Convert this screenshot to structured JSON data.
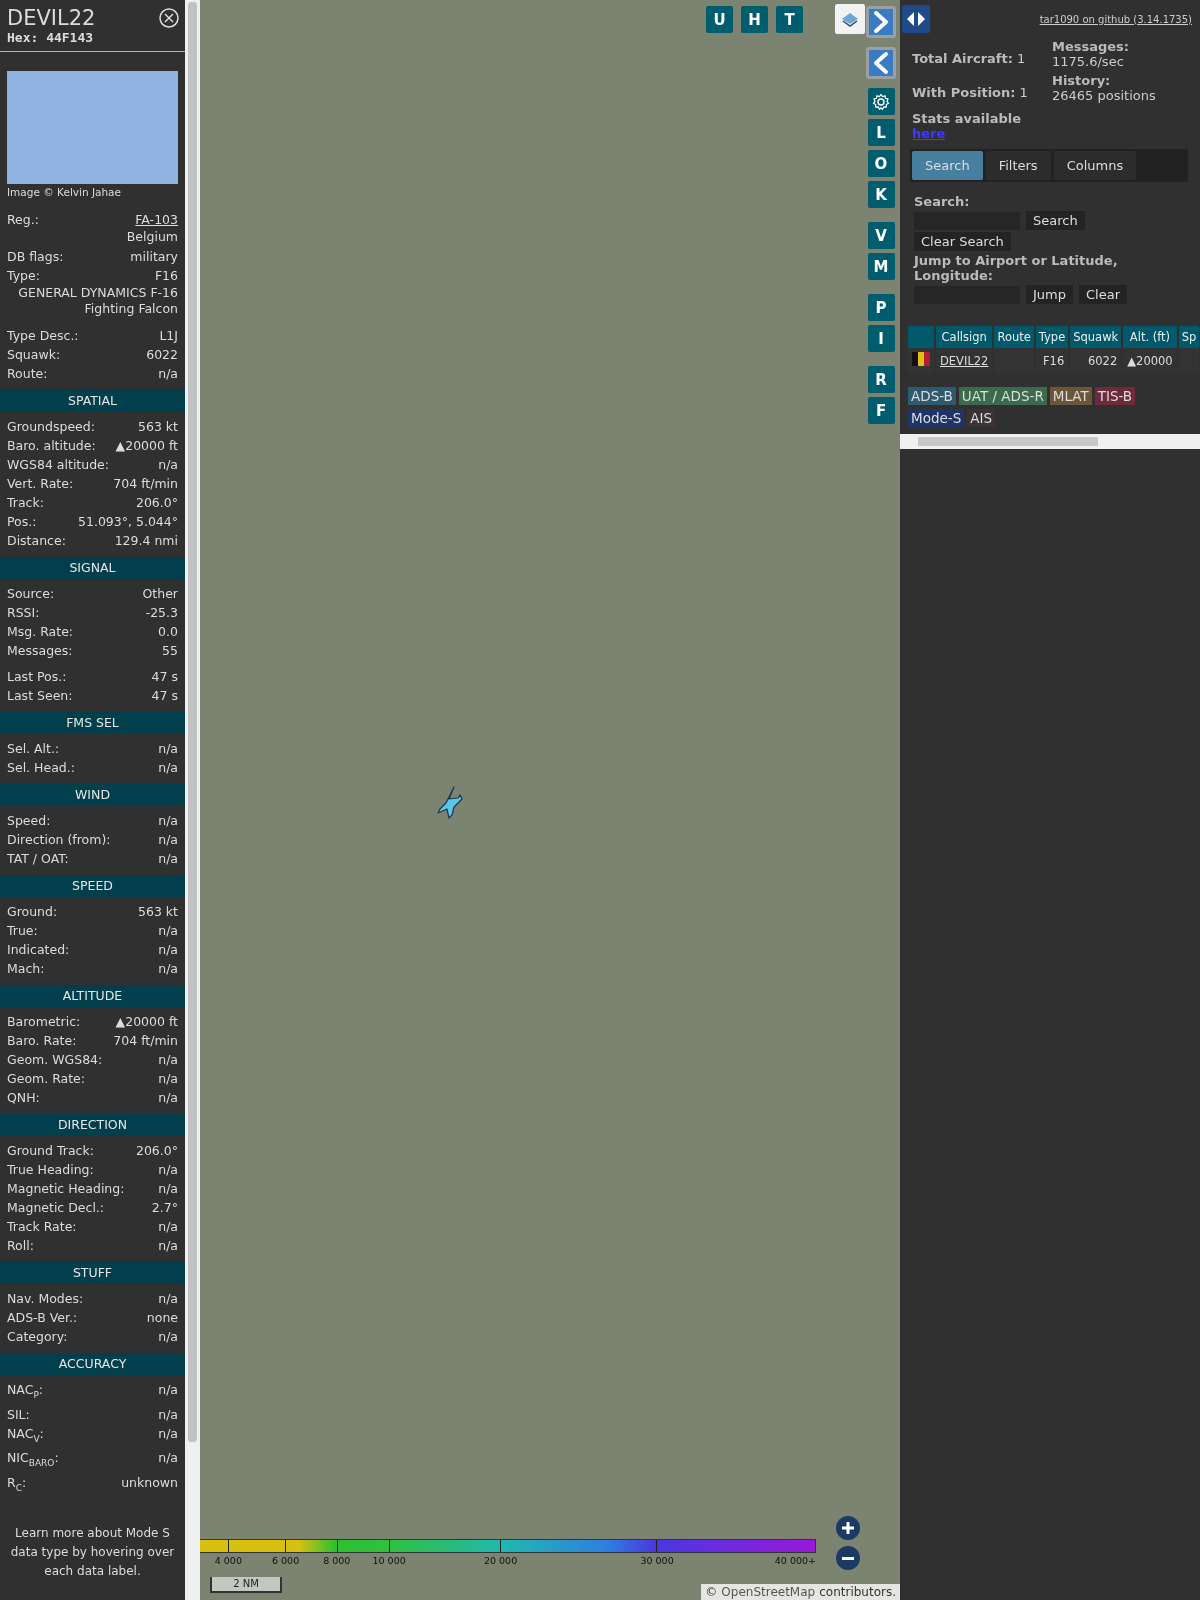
{
  "aircraft_panel": {
    "callsign": "DEVIL22",
    "hex": "Hex: 44F143",
    "photo_credit": "Image © Kelvin Jahae",
    "info_groups": [
      [
        {
          "label": "Reg.:",
          "value": "FA-103",
          "kind": "link"
        },
        {
          "value": "Belgium",
          "kind": "value_only"
        },
        {
          "label": "DB flags:",
          "value": "military",
          "kind": "pair"
        },
        {
          "label": "Type:",
          "value": "F16",
          "kind": "pair"
        },
        {
          "value": "GENERAL DYNAMICS F-16 Fighting Falcon",
          "kind": "value_only"
        }
      ],
      [
        {
          "label": "Type Desc.:",
          "value": "L1J",
          "kind": "pair"
        },
        {
          "label": "Squawk:",
          "value": "6022",
          "kind": "pair"
        },
        {
          "label": "Route:",
          "value": "n/a",
          "kind": "pair"
        }
      ]
    ],
    "sections": [
      {
        "title": "SPATIAL",
        "groups": [
          [
            {
              "label": "Groundspeed:",
              "value": "563 kt"
            },
            {
              "label": "Baro. altitude:",
              "value": "▲20000 ft"
            },
            {
              "label": "WGS84 altitude:",
              "value": "n/a"
            },
            {
              "label": "Vert. Rate:",
              "value": "704 ft/min"
            },
            {
              "label": "Track:",
              "value": "206.0°"
            },
            {
              "label": "Pos.:",
              "value": "51.093°, 5.044°"
            },
            {
              "label": "Distance:",
              "value": "129.4 nmi"
            }
          ]
        ]
      },
      {
        "title": "SIGNAL",
        "groups": [
          [
            {
              "label": "Source:",
              "value": "Other"
            },
            {
              "label": "RSSI:",
              "value": "-25.3"
            },
            {
              "label": "Msg. Rate:",
              "value": "0.0"
            },
            {
              "label": "Messages:",
              "value": "55"
            }
          ],
          [
            {
              "label": "Last Pos.:",
              "value": "47 s"
            },
            {
              "label": "Last Seen:",
              "value": "47 s"
            }
          ]
        ]
      },
      {
        "title": "FMS SEL",
        "groups": [
          [
            {
              "label": "Sel. Alt.:",
              "value": "n/a"
            },
            {
              "label": "Sel. Head.:",
              "value": "n/a"
            }
          ]
        ]
      },
      {
        "title": "WIND",
        "groups": [
          [
            {
              "label": "Speed:",
              "value": "n/a"
            },
            {
              "label": "Direction (from):",
              "value": "n/a"
            },
            {
              "label": "TAT / OAT:",
              "value": "n/a"
            }
          ]
        ]
      },
      {
        "title": "SPEED",
        "groups": [
          [
            {
              "label": "Ground:",
              "value": "563 kt"
            },
            {
              "label": "True:",
              "value": "n/a"
            },
            {
              "label": "Indicated:",
              "value": "n/a"
            },
            {
              "label": "Mach:",
              "value": "n/a"
            }
          ]
        ]
      },
      {
        "title": "ALTITUDE",
        "groups": [
          [
            {
              "label": "Barometric:",
              "value": "▲20000 ft"
            },
            {
              "label": "Baro. Rate:",
              "value": "704 ft/min"
            },
            {
              "label": "Geom. WGS84:",
              "value": "n/a"
            },
            {
              "label": "Geom. Rate:",
              "value": "n/a"
            },
            {
              "label": "QNH:",
              "value": "n/a"
            }
          ]
        ]
      },
      {
        "title": "DIRECTION",
        "groups": [
          [
            {
              "label": "Ground Track:",
              "value": "206.0°"
            },
            {
              "label": "True Heading:",
              "value": "n/a"
            },
            {
              "label": "Magnetic Heading:",
              "value": "n/a"
            },
            {
              "label": "Magnetic Decl.:",
              "value": "2.7°"
            },
            {
              "label": "Track Rate:",
              "value": "n/a"
            },
            {
              "label": "Roll:",
              "value": "n/a"
            }
          ]
        ]
      },
      {
        "title": "STUFF",
        "groups": [
          [
            {
              "label": "Nav. Modes:",
              "value": "n/a"
            },
            {
              "label": "ADS-B Ver.:",
              "value": "none"
            },
            {
              "label": "Category:",
              "value": "n/a"
            }
          ]
        ]
      },
      {
        "title": "ACCURACY",
        "groups": [
          [
            {
              "label": "NAC$_{P}$:",
              "value": "n/a"
            },
            {
              "label": "SIL:",
              "value": "n/a"
            },
            {
              "label": "NAC$_{V}$:",
              "value": "n/a"
            },
            {
              "label": "NIC$_{BARO}$:",
              "value": "n/a"
            },
            {
              "label": "R$_{C}$:",
              "value": "unknown"
            }
          ]
        ]
      }
    ],
    "footer": "Learn more about Mode S data type by hovering over each data label."
  },
  "map": {
    "top_buttons": [
      "U",
      "H",
      "T"
    ],
    "side_buttons": [
      {
        "kind": "arrow_right"
      },
      {
        "kind": "arrow_left"
      },
      {
        "kind": "gear"
      },
      {
        "kind": "letter",
        "label": "L"
      },
      {
        "kind": "letter",
        "label": "O"
      },
      {
        "kind": "letter",
        "label": "K"
      },
      {
        "kind": "letter",
        "label": "V"
      },
      {
        "kind": "letter",
        "label": "M"
      },
      {
        "kind": "letter",
        "label": "P"
      },
      {
        "kind": "letter",
        "label": "I"
      },
      {
        "kind": "letter",
        "label": "R"
      },
      {
        "kind": "letter",
        "label": "F"
      }
    ],
    "altitude_legend": [
      "4 000",
      "6 000",
      "8 000",
      "10 000",
      "20 000",
      "30 000",
      "40 000+"
    ],
    "scale": "2 NM",
    "attribution_prefix": "©",
    "attribution_link": "OpenStreetMap",
    "attribution_suffix": "contributors."
  },
  "side_panel": {
    "github_link": "tar1090 on github (3.14.1735)",
    "stats": [
      {
        "label": "Total Aircraft:",
        "value": "1"
      },
      {
        "label": "Messages:",
        "value": "1175.6/sec"
      },
      {
        "label": "With Position:",
        "value": "1"
      },
      {
        "label": "History:",
        "value": "26465 positions"
      }
    ],
    "stats_text": "Stats available",
    "stats_link": "here",
    "tabs": [
      {
        "label": "Search",
        "selected": true
      },
      {
        "label": "Filters",
        "selected": false
      },
      {
        "label": "Columns",
        "selected": false
      }
    ],
    "search_label": "Search:",
    "search_button": "Search",
    "clear_search_button": "Clear Search",
    "jump_label": "Jump to Airport or Latitude, Longitude:",
    "jump_button": "Jump",
    "clear_button": "Clear",
    "table": {
      "columns": [
        "Callsign",
        "Route",
        "Type",
        "Squawk",
        "Alt. (ft)",
        "Sp"
      ],
      "rows": [
        {
          "callsign": "DEVIL22",
          "route": "",
          "type": "F16",
          "squawk": "6022",
          "altitude": "▲20000"
        }
      ]
    },
    "sources": [
      {
        "label": "ADS-B",
        "color": "#2e5a6e"
      },
      {
        "label": "UAT / ADS-R",
        "color": "#3b6a4c"
      },
      {
        "label": "MLAT",
        "color": "#6b5639"
      },
      {
        "label": "TIS-B",
        "color": "#6e2b3b"
      },
      {
        "label": "Mode-S",
        "color": "#1f3569"
      },
      {
        "label": "AIS",
        "color": "#3b3236"
      }
    ]
  }
}
